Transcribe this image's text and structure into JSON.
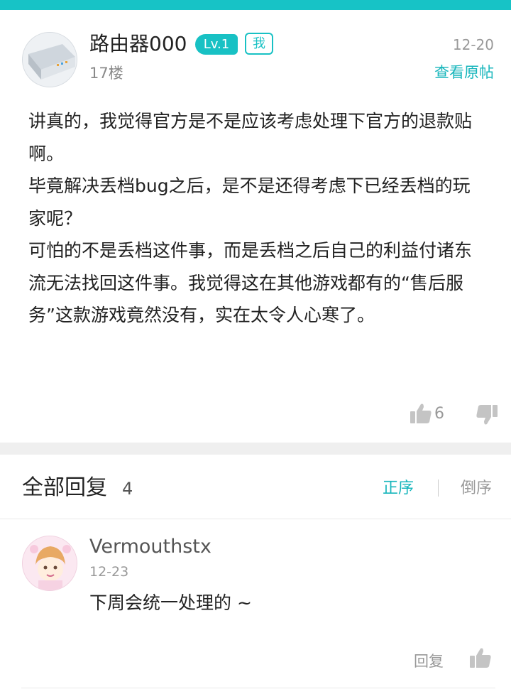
{
  "post": {
    "username": "路由器000",
    "level": "Lv.1",
    "me_badge": "我",
    "floor": "17楼",
    "date": "12-20",
    "view_original": "查看原帖",
    "paragraphs": [
      "讲真的，我觉得官方是不是应该考虑处理下官方的退款贴啊。",
      "毕竟解决丢档bug之后，是不是还得考虑下已经丢档的玩家呢？",
      "可怕的不是丢档这件事，而是丢档之后自己的利益付诸东流无法找回这件事。我觉得这在其他游戏都有的“售后服务”这款游戏竟然没有，实在太令人心寒了。"
    ],
    "like_count": "6",
    "icons": {
      "like": "thumbs-up-icon",
      "dislike": "thumbs-down-icon"
    }
  },
  "replies_header": {
    "title": "全部回复",
    "count": "4",
    "sort_asc": "正序",
    "sort_desc": "倒序"
  },
  "replies": [
    {
      "username": "Vermouthstx",
      "date": "12-23",
      "text": "下周会统一处理的 ~",
      "reply_label": "回复"
    }
  ],
  "colors": {
    "accent": "#17c3c6",
    "link": "#18b6bc",
    "muted": "#999999",
    "divider": "#efefef"
  }
}
